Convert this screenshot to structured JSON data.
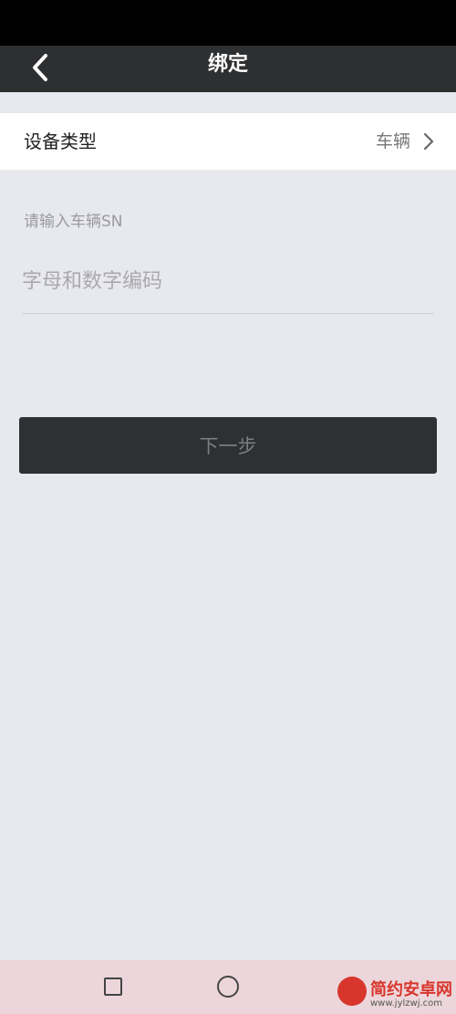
{
  "header": {
    "title": "绑定",
    "back_icon": "chevron-left-icon"
  },
  "device_type": {
    "label": "设备类型",
    "value": "车辆",
    "icon": "chevron-right-icon"
  },
  "sn_form": {
    "label": "请输入车辆SN",
    "placeholder": "字母和数字编码",
    "value": ""
  },
  "next_button": {
    "label": "下一步"
  },
  "system_nav": {
    "recent_icon": "square-icon",
    "home_icon": "circle-icon"
  },
  "watermark": {
    "title": "简约安卓网",
    "url": "www.jylzwj.com"
  },
  "colors": {
    "nav_bar": "#2e2f31",
    "background": "#e8e9ef",
    "button": "#2f3033",
    "watermark_red": "#d8362d"
  }
}
